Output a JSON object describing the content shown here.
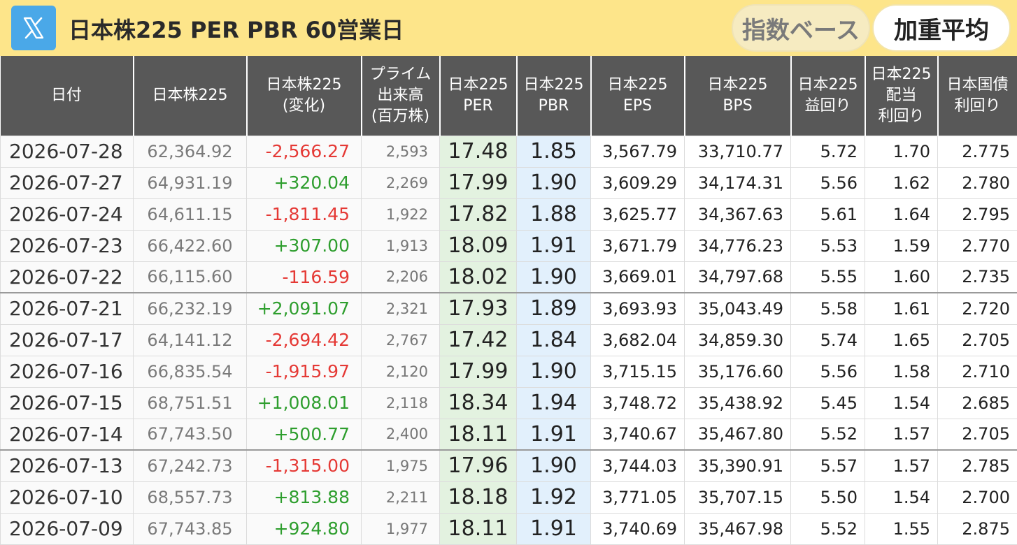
{
  "header": {
    "title": "日本株225 PER PBR 60営業日",
    "logo_icon": "x-logo-icon",
    "toggle_index_label": "指数ベース",
    "toggle_weighted_label": "加重平均",
    "active_toggle": "加重平均"
  },
  "colors": {
    "topbar": "#fde58a",
    "header_bg": "#585858",
    "negative": "#e53935",
    "positive": "#2e9e2e",
    "per_bg": "#e3f2e0",
    "pbr_bg": "#e2f0fc"
  },
  "columns": [
    {
      "lines": [
        "日付"
      ]
    },
    {
      "lines": [
        "日本株225"
      ]
    },
    {
      "lines": [
        "日本株225",
        "(変化)"
      ]
    },
    {
      "lines": [
        "プライム",
        "出来高",
        "(百万株)"
      ]
    },
    {
      "lines": [
        "日本225",
        "PER"
      ]
    },
    {
      "lines": [
        "日本225",
        "PBR"
      ]
    },
    {
      "lines": [
        "日本225",
        "EPS"
      ]
    },
    {
      "lines": [
        "日本225",
        "BPS"
      ]
    },
    {
      "lines": [
        "日本225",
        "益回り"
      ]
    },
    {
      "lines": [
        "日本225",
        "配当",
        "利回り"
      ]
    },
    {
      "lines": [
        "日本国債",
        "利回り"
      ]
    }
  ],
  "rows": [
    {
      "date": "2026-07-28",
      "close": "62,364.92",
      "change": "-2,566.27",
      "dir": "neg",
      "volume": "2,593",
      "per": "17.48",
      "pbr": "1.85",
      "eps": "3,567.79",
      "bps": "33,710.77",
      "ey": "5.72",
      "dy": "1.70",
      "jgb": "2.775"
    },
    {
      "date": "2026-07-27",
      "close": "64,931.19",
      "change": "+320.04",
      "dir": "pos",
      "volume": "2,269",
      "per": "17.99",
      "pbr": "1.90",
      "eps": "3,609.29",
      "bps": "34,174.31",
      "ey": "5.56",
      "dy": "1.62",
      "jgb": "2.780"
    },
    {
      "date": "2026-07-24",
      "close": "64,611.15",
      "change": "-1,811.45",
      "dir": "neg",
      "volume": "1,922",
      "per": "17.82",
      "pbr": "1.88",
      "eps": "3,625.77",
      "bps": "34,367.63",
      "ey": "5.61",
      "dy": "1.64",
      "jgb": "2.795"
    },
    {
      "date": "2026-07-23",
      "close": "66,422.60",
      "change": "+307.00",
      "dir": "pos",
      "volume": "1,913",
      "per": "18.09",
      "pbr": "1.91",
      "eps": "3,671.79",
      "bps": "34,776.23",
      "ey": "5.53",
      "dy": "1.59",
      "jgb": "2.770"
    },
    {
      "date": "2026-07-22",
      "close": "66,115.60",
      "change": "-116.59",
      "dir": "neg",
      "volume": "2,206",
      "per": "18.02",
      "pbr": "1.90",
      "eps": "3,669.01",
      "bps": "34,797.68",
      "ey": "5.55",
      "dy": "1.60",
      "jgb": "2.735"
    },
    {
      "date": "2026-07-21",
      "close": "66,232.19",
      "change": "+2,091.07",
      "dir": "pos",
      "volume": "2,321",
      "per": "17.93",
      "pbr": "1.89",
      "eps": "3,693.93",
      "bps": "35,043.49",
      "ey": "5.58",
      "dy": "1.61",
      "jgb": "2.720",
      "sep": true
    },
    {
      "date": "2026-07-17",
      "close": "64,141.12",
      "change": "-2,694.42",
      "dir": "neg",
      "volume": "2,767",
      "per": "17.42",
      "pbr": "1.84",
      "eps": "3,682.04",
      "bps": "34,859.30",
      "ey": "5.74",
      "dy": "1.65",
      "jgb": "2.705"
    },
    {
      "date": "2026-07-16",
      "close": "66,835.54",
      "change": "-1,915.97",
      "dir": "neg",
      "volume": "2,120",
      "per": "17.99",
      "pbr": "1.90",
      "eps": "3,715.15",
      "bps": "35,176.60",
      "ey": "5.56",
      "dy": "1.58",
      "jgb": "2.710"
    },
    {
      "date": "2026-07-15",
      "close": "68,751.51",
      "change": "+1,008.01",
      "dir": "pos",
      "volume": "2,118",
      "per": "18.34",
      "pbr": "1.94",
      "eps": "3,748.72",
      "bps": "35,438.92",
      "ey": "5.45",
      "dy": "1.54",
      "jgb": "2.685"
    },
    {
      "date": "2026-07-14",
      "close": "67,743.50",
      "change": "+500.77",
      "dir": "pos",
      "volume": "2,400",
      "per": "18.11",
      "pbr": "1.91",
      "eps": "3,740.67",
      "bps": "35,467.80",
      "ey": "5.52",
      "dy": "1.57",
      "jgb": "2.705"
    },
    {
      "date": "2026-07-13",
      "close": "67,242.73",
      "change": "-1,315.00",
      "dir": "neg",
      "volume": "1,975",
      "per": "17.96",
      "pbr": "1.90",
      "eps": "3,744.03",
      "bps": "35,390.91",
      "ey": "5.57",
      "dy": "1.57",
      "jgb": "2.785",
      "sep": true
    },
    {
      "date": "2026-07-10",
      "close": "68,557.73",
      "change": "+813.88",
      "dir": "pos",
      "volume": "2,211",
      "per": "18.18",
      "pbr": "1.92",
      "eps": "3,771.05",
      "bps": "35,707.15",
      "ey": "5.50",
      "dy": "1.54",
      "jgb": "2.700"
    },
    {
      "date": "2026-07-09",
      "close": "67,743.85",
      "change": "+924.80",
      "dir": "pos",
      "volume": "1,977",
      "per": "18.11",
      "pbr": "1.91",
      "eps": "3,740.69",
      "bps": "35,467.98",
      "ey": "5.52",
      "dy": "1.55",
      "jgb": "2.875"
    }
  ]
}
